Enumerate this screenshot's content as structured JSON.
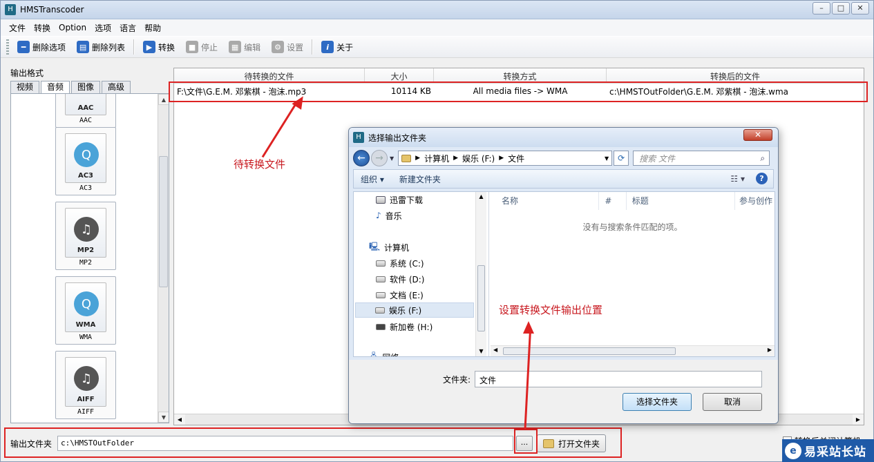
{
  "window": {
    "title": "HMSTranscoder"
  },
  "menu": [
    "文件",
    "转换",
    "Option",
    "选项",
    "语言",
    "帮助"
  ],
  "toolbar": {
    "delete_selected": "删除选项",
    "delete_list": "删除列表",
    "convert": "转换",
    "stop": "停止",
    "edit": "编辑",
    "settings": "设置",
    "about": "关于"
  },
  "left": {
    "output_format_label": "输出格式",
    "tabs": [
      "视频",
      "音频",
      "图像",
      "高级"
    ],
    "active_tab": "音频",
    "formats": [
      {
        "code": "AAC",
        "caption": "AAC"
      },
      {
        "code": "AC3",
        "caption": "AC3"
      },
      {
        "code": "MP2",
        "caption": "MP2"
      },
      {
        "code": "WMA",
        "caption": "WMA"
      },
      {
        "code": "AIFF",
        "caption": "AIFF"
      }
    ]
  },
  "table": {
    "headers": [
      "待转换的文件",
      "大小",
      "转换方式",
      "转换后的文件"
    ],
    "rows": [
      {
        "source": "F:\\文件\\G.E.M. 邓紫棋 - 泡沫.mp3",
        "size": "10114 KB",
        "method": "All media files -> WMA",
        "target": "c:\\HMSTOutFolder\\G.E.M. 邓紫棋 - 泡沫.wma"
      }
    ]
  },
  "bottom": {
    "output_folder_label": "输出文件夹",
    "output_folder_value": "c:\\HMSTOutFolder",
    "browse_label": "...",
    "open_folder_label": "打开文件夹",
    "close_after_label": "转换后关闭计算机"
  },
  "annotations": {
    "pending_file": "待转换文件",
    "set_output": "设置转换文件输出位置"
  },
  "dialog": {
    "title": "选择输出文件夹",
    "breadcrumb": [
      "计算机",
      "娱乐 (F:)",
      "文件"
    ],
    "search_placeholder": "搜索 文件",
    "organize": "组织 ▾",
    "new_folder": "新建文件夹",
    "tree": [
      {
        "label": "迅雷下载",
        "icon": "download-folder-icon"
      },
      {
        "label": "音乐",
        "icon": "music-icon"
      },
      {
        "label": "计算机",
        "icon": "computer-icon"
      },
      {
        "label": "系统 (C:)",
        "icon": "drive-icon"
      },
      {
        "label": "软件 (D:)",
        "icon": "drive-icon"
      },
      {
        "label": "文档 (E:)",
        "icon": "drive-icon"
      },
      {
        "label": "娱乐 (F:)",
        "icon": "drive-icon"
      },
      {
        "label": "新加卷 (H:)",
        "icon": "drive-icon"
      },
      {
        "label": "网络",
        "icon": "network-icon"
      }
    ],
    "selected_tree_item": "娱乐 (F:)",
    "columns": [
      "名称",
      "#",
      "标题",
      "参与创作"
    ],
    "empty_message": "没有与搜索条件匹配的项。",
    "filename_label": "文件夹:",
    "filename_value": "文件",
    "select_button": "选择文件夹",
    "cancel_button": "取消"
  },
  "watermark": {
    "text": "易采站长站"
  },
  "colors": {
    "annotation_red": "#d22222",
    "titlebar": "#c5d5ea",
    "dialog_frame": "#dfe9f6"
  }
}
